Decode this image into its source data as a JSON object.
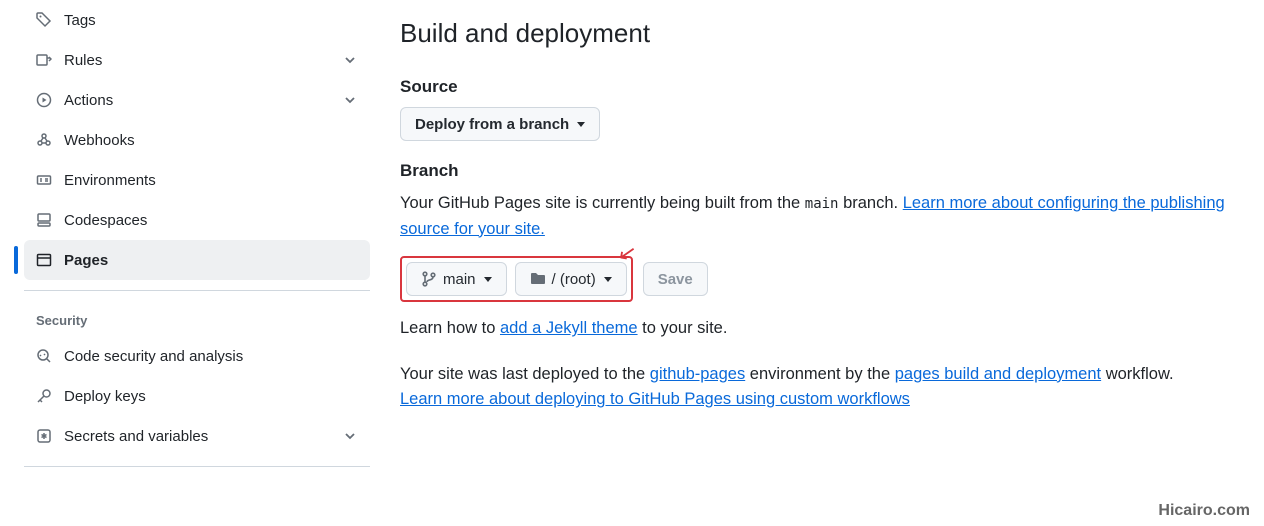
{
  "sidebar": {
    "items": [
      {
        "label": "Tags",
        "icon": "tag"
      },
      {
        "label": "Rules",
        "icon": "rules",
        "expandable": true
      },
      {
        "label": "Actions",
        "icon": "play",
        "expandable": true
      },
      {
        "label": "Webhooks",
        "icon": "webhook"
      },
      {
        "label": "Environments",
        "icon": "server"
      },
      {
        "label": "Codespaces",
        "icon": "codespaces"
      },
      {
        "label": "Pages",
        "icon": "browser",
        "active": true
      }
    ],
    "security_header": "Security",
    "security_items": [
      {
        "label": "Code security and analysis",
        "icon": "codescan"
      },
      {
        "label": "Deploy keys",
        "icon": "key"
      },
      {
        "label": "Secrets and variables",
        "icon": "asterisk",
        "expandable": true
      }
    ]
  },
  "main": {
    "title": "Build and deployment",
    "source": {
      "heading": "Source",
      "button": "Deploy from a branch"
    },
    "branch": {
      "heading": "Branch",
      "desc_pre": "Your GitHub Pages site is currently being built from the ",
      "desc_code": "main",
      "desc_post": " branch. ",
      "learn_link": "Learn more about configuring the publishing source for your site.",
      "branch_btn": "main",
      "folder_btn": "/ (root)",
      "save_btn": "Save"
    },
    "jekyll": {
      "pre": "Learn how to ",
      "link": "add a Jekyll theme",
      "post": " to your site."
    },
    "deploy": {
      "pre": "Your site was last deployed to the ",
      "env_link": "github-pages",
      "mid": " environment by the ",
      "workflow_link": "pages build and deployment",
      "post": " workflow.",
      "learn_link": "Learn more about deploying to GitHub Pages using custom workflows"
    }
  },
  "watermark": "Hicairo.com"
}
